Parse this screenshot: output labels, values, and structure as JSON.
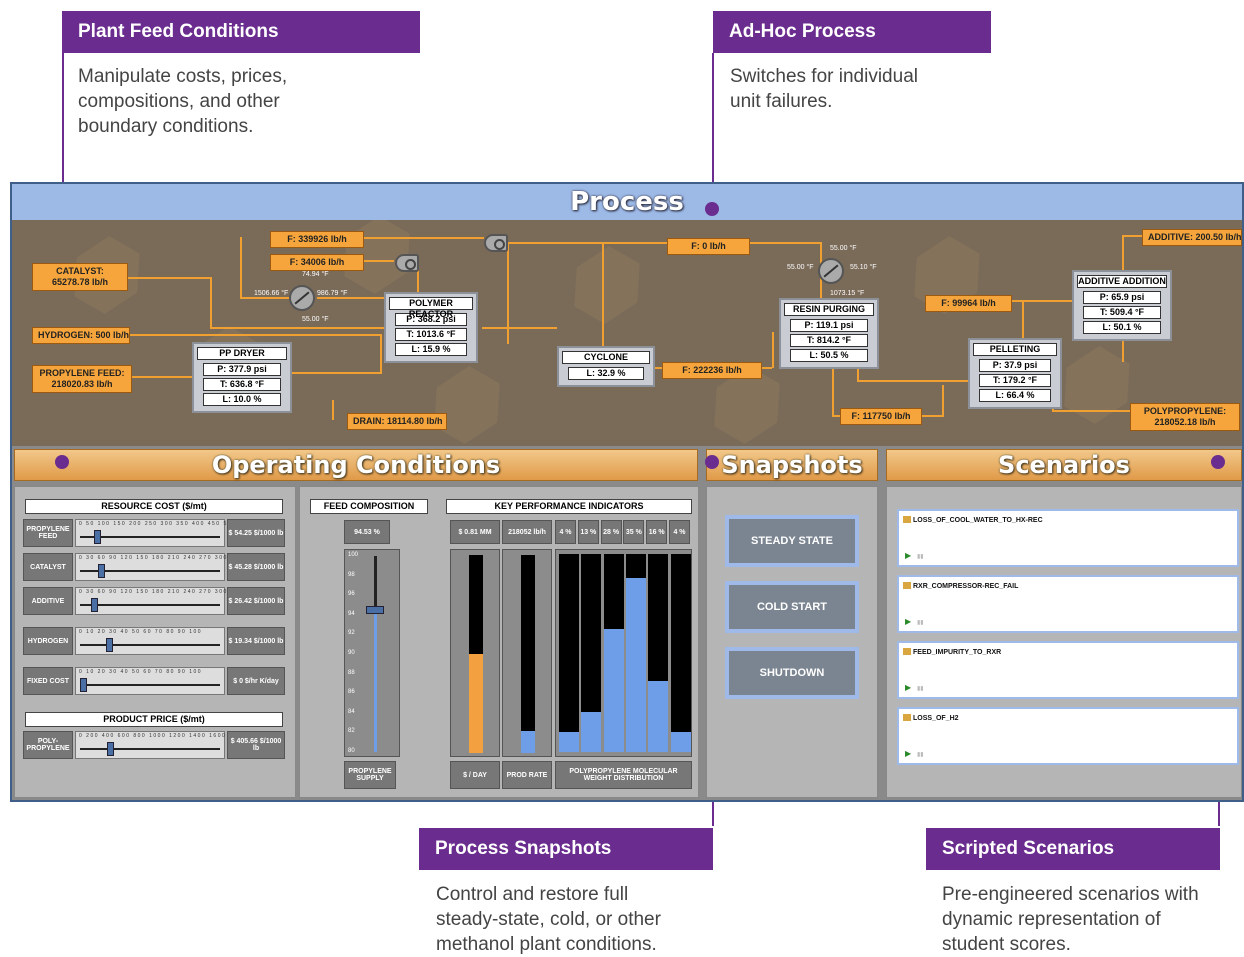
{
  "callouts": {
    "plant_feed": {
      "title": "Plant Feed Conditions",
      "text1": "Manipulate costs, prices,",
      "text2": "compositions, and other",
      "text3": "boundary conditions."
    },
    "adhoc": {
      "title": "Ad-Hoc Process",
      "text1": "Switches for individual",
      "text2": "unit failures."
    },
    "snapshots": {
      "title": "Process Snapshots",
      "text1": "Control and restore full",
      "text2": "steady-state, cold, or other",
      "text3": "methanol plant conditions."
    },
    "scenarios": {
      "title": "Scripted Scenarios",
      "text1": "Pre-engineered scenarios with",
      "text2": "dynamic representation of",
      "text3": "student scores."
    }
  },
  "process": {
    "title": "Process",
    "tags": {
      "f1": "F: 339926 lb/h",
      "f2": "F: 34006 lb/h",
      "f3": "F: 0 lb/h",
      "catalyst": "CATALYST: 65278.78 lb/h",
      "hydrogen": "HYDROGEN: 500 lb/h",
      "propylene": "PROPYLENE FEED: 218020.83 lb/h",
      "drain": "DRAIN: 18114.80 lb/h",
      "f4": "F: 222236 lb/h",
      "f5": "F: 99964 lb/h",
      "f6": "F: 117750 lb/h",
      "additive": "ADDITIVE: 200.50 lb/h",
      "polypropylene": "POLYPROPYLENE: 218052.18 lb/h"
    },
    "temps": {
      "t1": "74.94 °F",
      "t2": "1506.66 °F",
      "t3": "986.79 °F",
      "t4": "55.00 °F",
      "t5": "55.00 °F",
      "t6": "55.00 °F",
      "t7": "55.10 °F",
      "t8": "1073.15 °F"
    },
    "reactor": {
      "title": "POLYMER REACTOR",
      "p": "P: 368.2 psi",
      "t": "T: 1013.6 °F",
      "l": "L: 15.9 %"
    },
    "dryer": {
      "title": "PP DRYER",
      "p": "P: 377.9 psi",
      "t": "T: 636.8 °F",
      "l": "L: 10.0 %"
    },
    "cyclone": {
      "title": "CYCLONE",
      "l": "L: 32.9 %"
    },
    "purging": {
      "title": "RESIN PURGING",
      "p": "P: 119.1 psi",
      "t": "T: 814.2 °F",
      "l": "L: 50.5 %"
    },
    "additive_add": {
      "title": "ADDITIVE ADDITION",
      "p": "P: 65.9 psi",
      "t": "T: 509.4 °F",
      "l": "L: 50.1 %"
    },
    "pelleting": {
      "title": "PELLETING",
      "p": "P: 37.9 psi",
      "t": "T: 179.2 °F",
      "l": "L: 66.4 %"
    }
  },
  "operating": {
    "title": "Operating Conditions",
    "resource_cost": "RESOURCE COST ($/mt)",
    "product_price": "PRODUCT PRICE ($/mt)",
    "rows": [
      {
        "label": "PROPYLENE FEED",
        "ticks": "0 50 100 150 200 250 300 350 400 450 500",
        "value": "$ 54.25 $/1000 lb",
        "level": 0.1
      },
      {
        "label": "CATALYST",
        "ticks": "0 30 60 90 120 150 180 210 240 270 300",
        "value": "$ 45.28 $/1000 lb",
        "level": 0.13
      },
      {
        "label": "ADDITIVE",
        "ticks": "0 30 60 90 120 150 180 210 240 270 300",
        "value": "$ 26.42 $/1000 lb",
        "level": 0.08
      },
      {
        "label": "HYDROGEN",
        "ticks": "0 10 20 30 40 50 60 70 80 90 100",
        "value": "$ 19.34 $/1000 lb",
        "level": 0.19
      },
      {
        "label": "FIXED COST",
        "ticks": "0 10 20 30 40 50 60 70 80 90 100",
        "value": "$ 0 $/hr K/day",
        "level": 0.0
      },
      {
        "label": "POLY-PROPYLENE",
        "ticks": "0 200 400 600 800 1000 1200 1400 1600 1800 2000",
        "value": "$ 405.66 $/1000 lb",
        "level": 0.2
      }
    ],
    "feed_comp": {
      "title": "FEED COMPOSITION",
      "value": "94.53 %",
      "ticks": [
        "100",
        "98",
        "96",
        "94",
        "92",
        "90",
        "88",
        "86",
        "84",
        "82",
        "80"
      ],
      "label": "PROPYLENE SUPPLY",
      "level": 0.7265
    },
    "kpi": {
      "title": "KEY PERFORMANCE INDICATORS",
      "money": "$ 0.81 MM",
      "rate": "218052 lb/h",
      "dist": [
        "4 %",
        "13 %",
        "28 %",
        "35 %",
        "16 %",
        "4 %"
      ],
      "money_label": "$ / DAY",
      "rate_label": "PROD RATE",
      "dist_label": "POLYPROPYLENE MOLECULAR WEIGHT DISTRIBUTION",
      "money_level": 0.5,
      "rate_level": 0.11,
      "dist_levels": [
        0.1,
        0.2,
        0.62,
        0.88,
        0.36,
        0.1
      ],
      "colors": {
        "money": "#f2a040",
        "blue": "#6f9ee8"
      }
    }
  },
  "snapshots": {
    "title": "Snapshots",
    "buttons": [
      "STEADY STATE",
      "COLD START",
      "SHUTDOWN"
    ]
  },
  "scenarios": {
    "title": "Scenarios",
    "items": [
      "LOSS_OF_COOL_WATER_TO_HX-REC",
      "RXR_COMPRESSOR-REC_FAIL",
      "FEED_IMPURITY_TO_RXR",
      "LOSS_OF_H2"
    ],
    "play": "▶",
    "pause": "▮▮"
  }
}
